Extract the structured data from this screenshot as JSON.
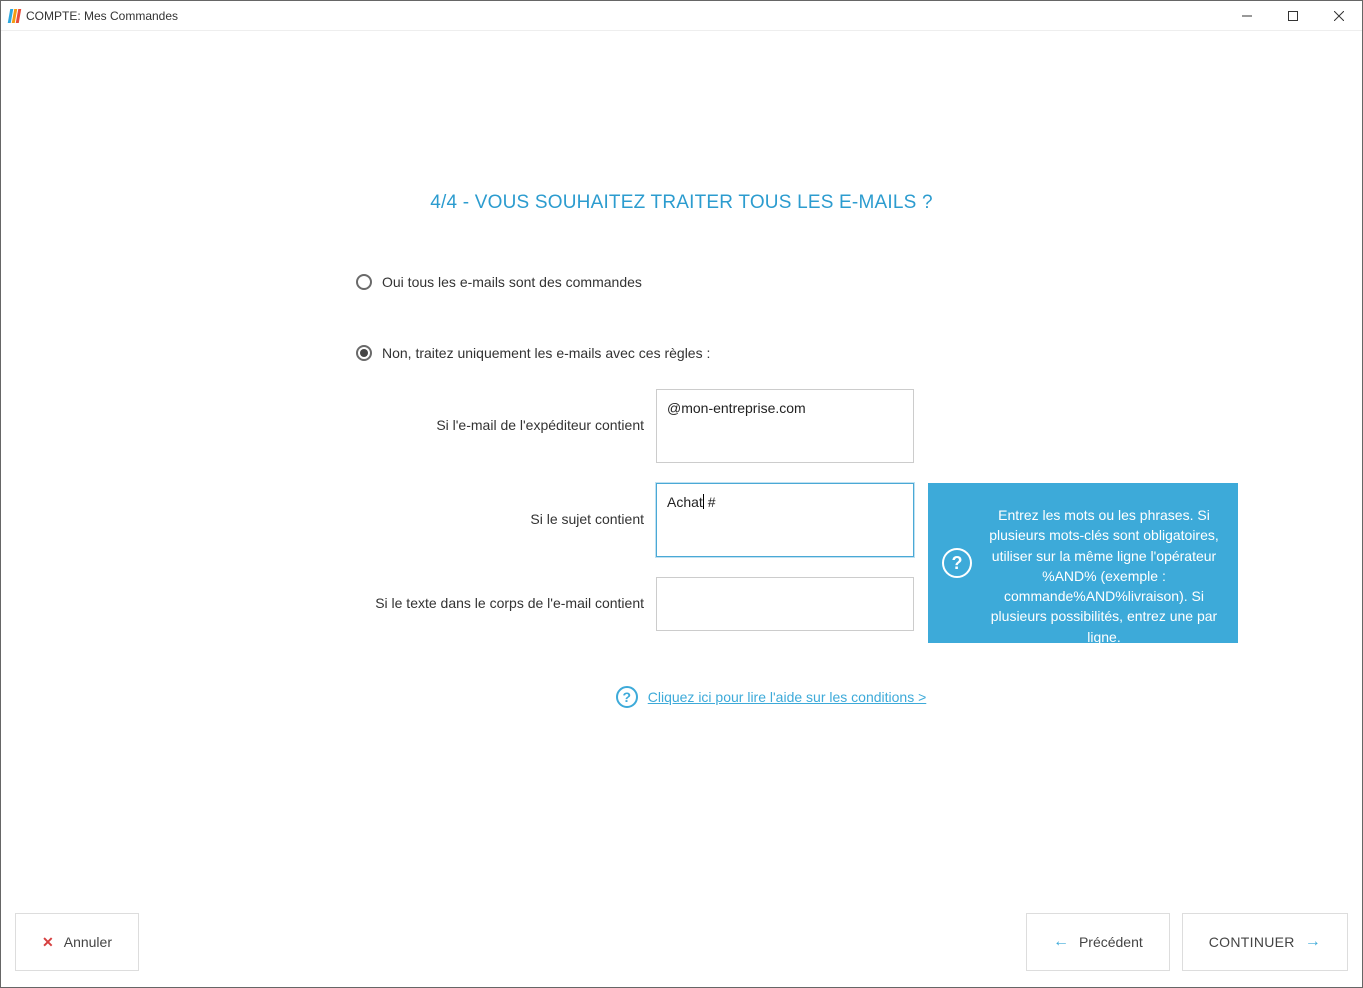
{
  "window": {
    "title": "COMPTE: Mes Commandes"
  },
  "page": {
    "title": "4/4 - VOUS SOUHAITEZ TRAITER TOUS LES E-MAILS ?"
  },
  "radio": {
    "option_all": "Oui tous les e-mails sont des commandes",
    "option_rules": "Non, traitez uniquement les e-mails avec ces règles :",
    "selected": "rules"
  },
  "rules": {
    "sender_label": "Si l'e-mail de l'expéditeur contient",
    "sender_value": "@mon-entreprise.com",
    "subject_label": "Si le sujet contient",
    "subject_value": "Achat #",
    "body_label": "Si le texte dans le corps de l'e-mail contient",
    "body_value": ""
  },
  "tooltip": {
    "text": "Entrez les mots ou les phrases. Si plusieurs mots-clés sont obligatoires, utiliser sur la même ligne l'opérateur %AND% (exemple : commande%AND%livraison). Si plusieurs possibilités, entrez une par ligne."
  },
  "help_link": "Cliquez ici pour lire l'aide sur les conditions >",
  "buttons": {
    "cancel": "Annuler",
    "previous": "Précédent",
    "continue": "CONTINUER"
  }
}
